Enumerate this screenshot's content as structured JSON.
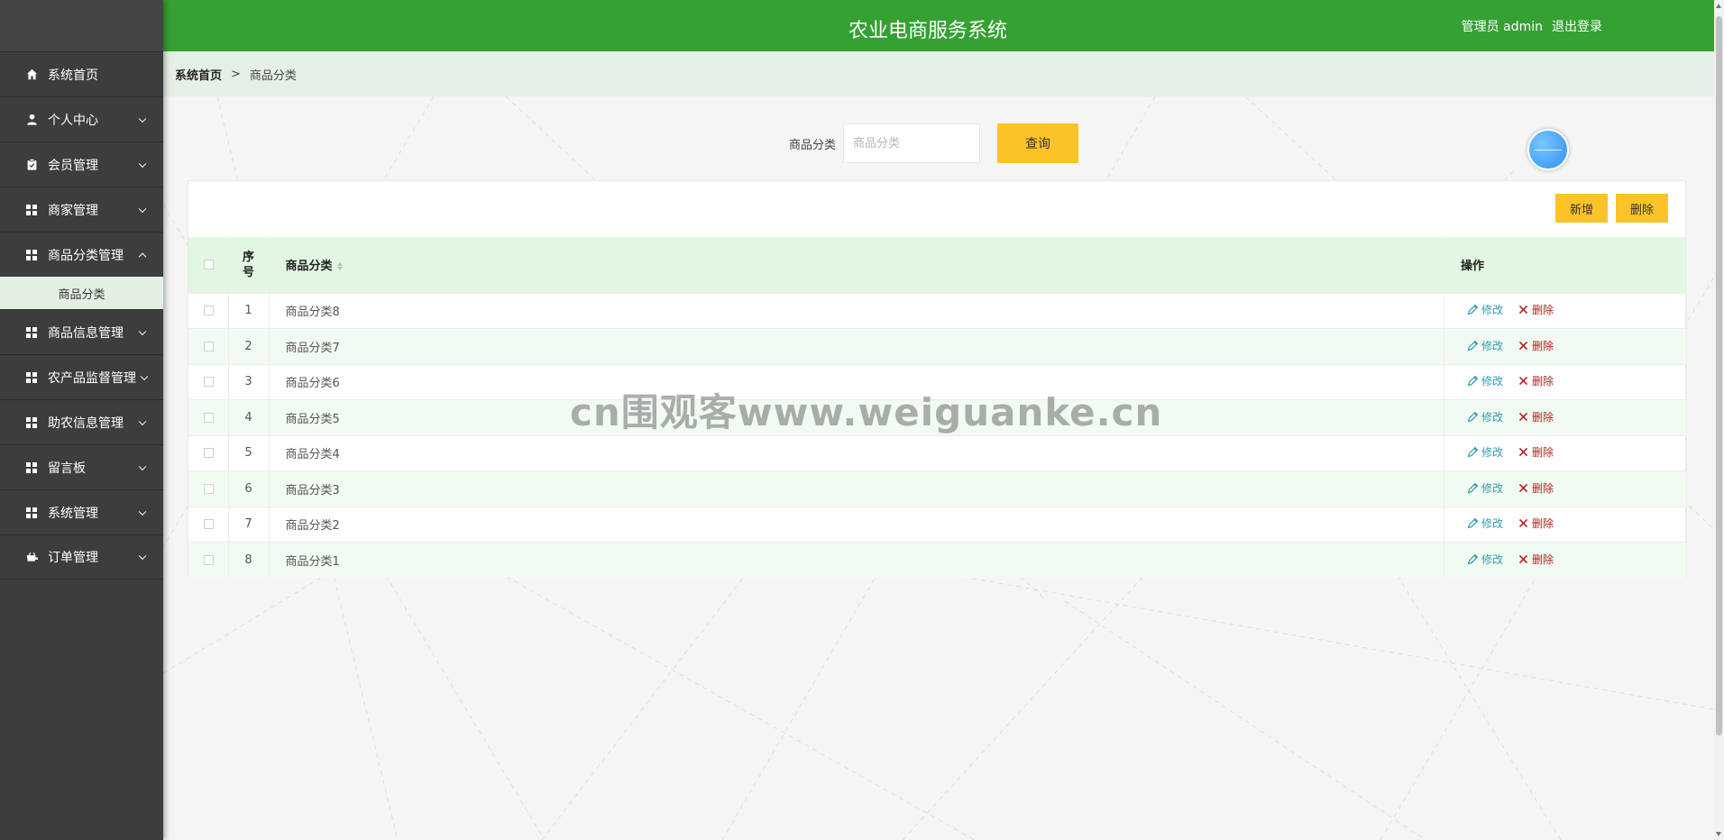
{
  "header": {
    "title": "农业电商服务系统",
    "user_label": "管理员 admin",
    "logout_label": "退出登录"
  },
  "colors": {
    "header_bg": "#35a132",
    "sidebar_bg": "#3d3d3d",
    "accent_button": "#fcc328",
    "table_header_bg": "#e2f7e1",
    "edit_color": "#2f9bb0",
    "delete_color": "#b22222"
  },
  "sidebar": {
    "items": [
      {
        "label": "系统首页",
        "icon": "home-icon"
      },
      {
        "label": "个人中心",
        "icon": "user-icon"
      },
      {
        "label": "会员管理",
        "icon": "clipboard-icon"
      },
      {
        "label": "商家管理",
        "icon": "grid-icon"
      },
      {
        "label": "商品分类管理",
        "icon": "grid-icon",
        "expanded": true
      },
      {
        "label": "商品信息管理",
        "icon": "grid-icon"
      },
      {
        "label": "农产品监督管理",
        "icon": "grid-icon"
      },
      {
        "label": "助农信息管理",
        "icon": "grid-icon"
      },
      {
        "label": "留言板",
        "icon": "grid-icon"
      },
      {
        "label": "系统管理",
        "icon": "grid-icon"
      },
      {
        "label": "订单管理",
        "icon": "cart-icon"
      }
    ],
    "submenu": {
      "label": "商品分类"
    }
  },
  "breadcrumb": {
    "home": "系统首页",
    "separator": ">",
    "current": "商品分类"
  },
  "search": {
    "label": "商品分类",
    "placeholder": "商品分类",
    "value": "",
    "button_label": "查询"
  },
  "toolbar": {
    "add_label": "新增",
    "delete_label": "删除"
  },
  "table": {
    "columns": {
      "index": "序号",
      "name": "商品分类",
      "actions": "操作"
    },
    "edit_label": "修改",
    "delete_label": "删除",
    "rows": [
      {
        "index": "1",
        "name": "商品分类8"
      },
      {
        "index": "2",
        "name": "商品分类7"
      },
      {
        "index": "3",
        "name": "商品分类6"
      },
      {
        "index": "4",
        "name": "商品分类5"
      },
      {
        "index": "5",
        "name": "商品分类4"
      },
      {
        "index": "6",
        "name": "商品分类3"
      },
      {
        "index": "7",
        "name": "商品分类2"
      },
      {
        "index": "8",
        "name": "商品分类1"
      }
    ]
  },
  "watermark": "cn围观客www.weiguanke.cn"
}
